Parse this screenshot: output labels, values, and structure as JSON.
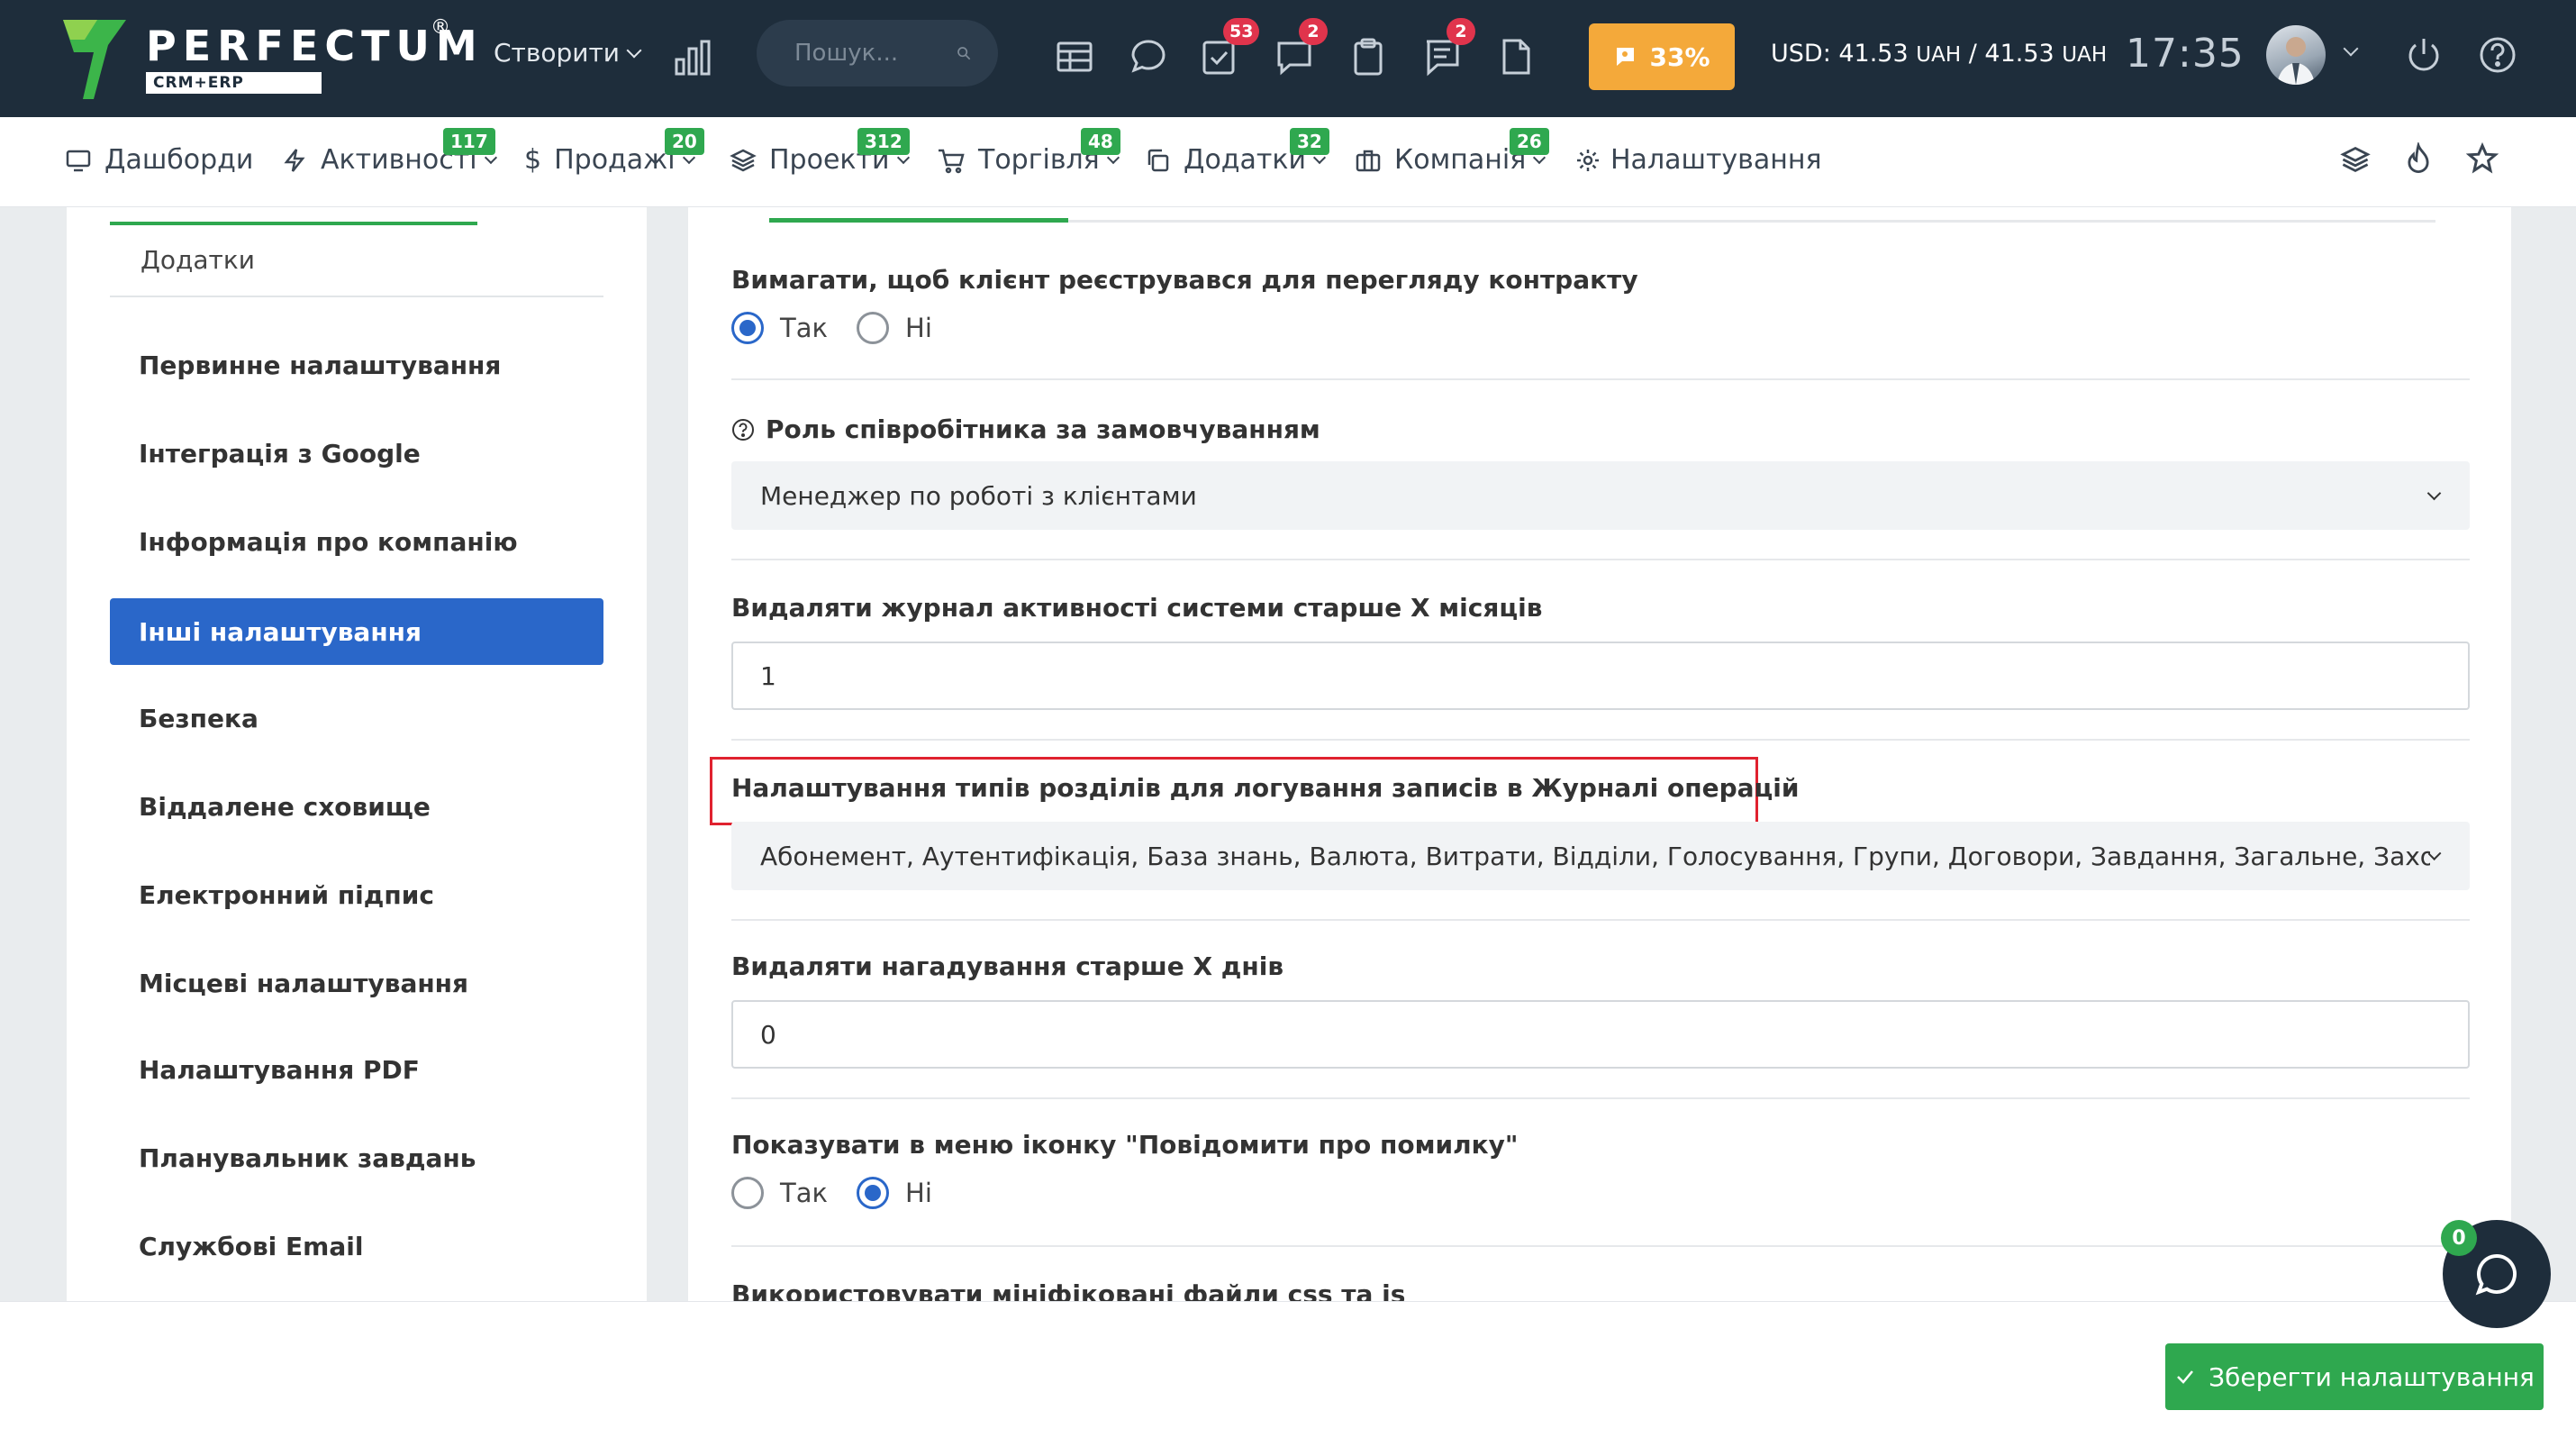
{
  "header": {
    "logo_text": "PERFECTUM",
    "logo_reg": "®",
    "logo_sub": "CRM+ERP",
    "create_label": "Створити",
    "search_placeholder": "Пошук...",
    "badges": {
      "tasks": "53",
      "chat": "2",
      "notes": "2"
    },
    "progress_label": "33%",
    "progress_value": 33,
    "currency_text": "USD: 41.53",
    "currency_unit1": "UAH",
    "currency_sep": " / 41.53 ",
    "currency_unit2": "UAH",
    "time": "17:35"
  },
  "nav": {
    "items": [
      {
        "label": "Дашборди",
        "badge": ""
      },
      {
        "label": "Активності",
        "badge": "117"
      },
      {
        "label": "Продажі",
        "badge": "20"
      },
      {
        "label": "Проекти",
        "badge": "312"
      },
      {
        "label": "Торгівля",
        "badge": "48"
      },
      {
        "label": "Додатки",
        "badge": "32"
      },
      {
        "label": "Компанія",
        "badge": "26"
      },
      {
        "label": "Налаштування",
        "badge": ""
      }
    ]
  },
  "sidebar": {
    "heading": "Додатки",
    "items": [
      {
        "label": "Первинне налаштування"
      },
      {
        "label": "Інтеграція з Google"
      },
      {
        "label": "Інформація про компанію"
      },
      {
        "label": "Інші налаштування"
      },
      {
        "label": "Безпека"
      },
      {
        "label": "Віддалене сховище"
      },
      {
        "label": "Електронний підпис"
      },
      {
        "label": "Місцеві налаштування"
      },
      {
        "label": "Налаштування PDF"
      },
      {
        "label": "Планувальник завдань"
      },
      {
        "label": "Службові Email"
      }
    ]
  },
  "settings": {
    "require_register": {
      "label": "Вимагати, щоб клієнт реєструвався для перегляду контракту",
      "yes": "Так",
      "no": "Ні"
    },
    "default_role": {
      "label": "Роль співробітника за замовчуванням",
      "value": "Менеджер по роботі з клієнтами"
    },
    "delete_activity_log": {
      "label": "Видаляти журнал активності системи старше X місяців",
      "value": "1"
    },
    "log_section_types": {
      "label": "Налаштування типів розділів для логування записів в Журналі операцій",
      "value": "Абонемент, Аутентифікація, База знань, Валюта, Витрати, Відділи, Голосування, Групи, Договори, Завдання, Загальне, Заходи, Клієнти, Кон"
    },
    "delete_reminders": {
      "label": "Видаляти нагадування старше X днів",
      "value": "0"
    },
    "show_bug_icon": {
      "label": "Показувати в меню іконку \"Повідомити про помилку\"",
      "yes": "Так",
      "no": "Ні"
    },
    "minified_files": {
      "label": "Використовувати мініфіковані файли css та js"
    }
  },
  "footer": {
    "save_label": "Зберегти налаштування"
  },
  "chat": {
    "badge": "0"
  },
  "colors": {
    "header_bg": "#1e2d3b",
    "accent_green": "#2fa84f",
    "accent_blue": "#2a67c9",
    "badge_red": "#e0344c",
    "progress_orange": "#f4a93a",
    "highlight_red": "#e0222f"
  }
}
